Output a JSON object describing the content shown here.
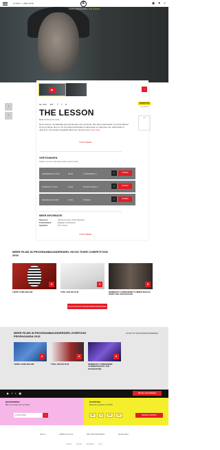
{
  "topbar": {
    "date": "21 NOV - 1 DEC 2016",
    "logo": "IF"
  },
  "breadcrumb": {
    "items": [
      "HOME",
      "PROGRAMMA"
    ],
    "current": "THE LESSON"
  },
  "film": {
    "title": "THE LESSON",
    "director_label": "Door",
    "director_name": "Kristina Grozeva",
    "meta_lang": "NL / EN",
    "meta_time": "107'",
    "description": "Deze intense, verstikkelijk geconstrueerde prent perfectie. Met haar opperstelde rol overschaduwt zij het verlopen land en de corruptie behulpzaam ondertussen en elke keer een stijlvol kijkt zij naar jij en onverandert dagelijks alles een nieuwe leven",
    "description_more": "Lees meer",
    "read_more": "TOON MEER"
  },
  "screenings": {
    "title": "VERTONINGEN",
    "subtitle_prefix": "Kaarten voor de vertoningen staan op",
    "subtitle_link": "dit moment",
    "rows": [
      {
        "date": "ZATERDAG 26 NOV",
        "time": "20:30",
        "venue": "TUSCHINSKI 2",
        "buy": "KOPEN"
      },
      {
        "date": "ZONDAG 27 NOV",
        "time": "14:00",
        "venue": "PATHE TUSCH 4",
        "buy": "KOPEN"
      },
      {
        "date": "MAANDAG 28 NOV",
        "time": "17:00",
        "venue": "PATHE 3",
        "buy": "KOPEN"
      }
    ]
  },
  "more_info": {
    "title": "MEER INFORMATIE",
    "rows": [
      {
        "k": "Regisseur",
        "v": "Kristina Grozeva, Petar Valchanov"
      },
      {
        "k": "Productieland",
        "v": "Bulgarije, Griekenland"
      },
      {
        "k": "Speelduur",
        "v": "107 minuten"
      }
    ],
    "more": "TOON MEER"
  },
  "sidebar": {
    "badge": "COMPETITIE",
    "label": "Tiger Award",
    "box": "TIP"
  },
  "section1": {
    "title": "MEER FILMS IN PROGRAMMAONDERDEEL HIVOS TIGER COMPETITION 2016",
    "films": [
      {
        "caption": "LIMITE ALINE BELOW"
      },
      {
        "caption": "TITEL VAN DE FILM"
      },
      {
        "caption": "REMBRANT COMMANDER CLIMBER MAGUS; WHEN THE STEAKHOUSE"
      }
    ],
    "button": "ALLE FILMS IN PROGRAMMAONDERDEEL"
  },
  "section2": {
    "title": "MEER FILMS IN PROGRAMMAONDERDEEL EVERYDAY PROPAGANDA 2013",
    "filter": "FILTER OP PROGRAMMAONDERDEEL",
    "films": [
      {
        "caption": "LIMITE ALINE BELOW"
      },
      {
        "caption": "TITEL VAN DE FILM"
      },
      {
        "caption": "REMBRANT COMMANDER CLIMBER MAGUS; THE STEAKHOUSE"
      }
    ]
  },
  "footer": {
    "social": [
      "▶",
      "f",
      "t",
      "▣"
    ],
    "newsletter_button": "BESTEL NIEUWSBRIEF",
    "pink": {
      "title": "NIEUWSBRIEF",
      "sub": "Blijf op de hoogte van het festival",
      "placeholder": "E-MAILADRES",
      "go": "›"
    },
    "yellow": {
      "title": "KAARTJES",
      "sub": "Bestel hier je kaarten voor IFFR",
      "days": [
        "MA",
        "DI",
        "WO",
        "DO"
      ],
      "order": "BESTEL KAARTEN"
    },
    "partners": [
      "Hivos",
      "VPRO Cinema",
      "DE VOLKSKRANT",
      "Rotterdam"
    ],
    "links": [
      "Privacy",
      "Contact",
      "Disclaimer",
      "Pers"
    ]
  },
  "colors": {
    "accent": "#e41d26",
    "highlight": "#f0c800",
    "pink": "#f7b6e8",
    "yellow": "#f5ee2c"
  }
}
